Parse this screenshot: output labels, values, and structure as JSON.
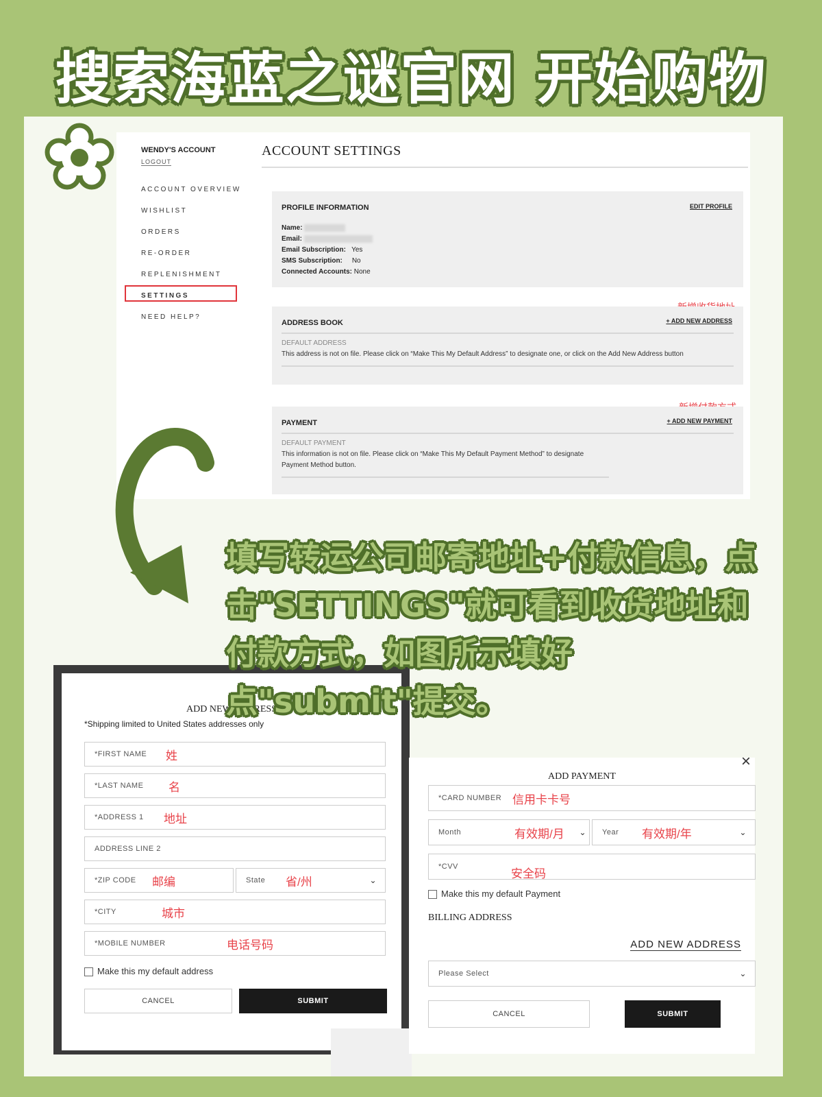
{
  "headline": "搜索海蓝之谜官网 开始购物",
  "instruction": "填写转运公司邮寄地址+付款信息，点击\"SETTINGS\"就可看到收货地址和付款方式，如图所示填好点\"submit\"提交。",
  "colors": {
    "background": "#a9c476",
    "accent_dark_green": "#5b7a32",
    "annotation_red": "#e8434a",
    "highlight_box": "#e0343a"
  },
  "account": {
    "account_name": "WENDY'S ACCOUNT",
    "logout": "LOGOUT",
    "nav": [
      "ACCOUNT OVERVIEW",
      "WISHLIST",
      "ORDERS",
      "RE-ORDER",
      "REPLENISHMENT",
      "SETTINGS",
      "NEED HELP?"
    ],
    "page_title": "ACCOUNT SETTINGS",
    "profile": {
      "title": "PROFILE INFORMATION",
      "edit": "EDIT PROFILE",
      "name_label": "Name:",
      "email_label": "Email:",
      "email_sub_label": "Email Subscription:",
      "email_sub": "Yes",
      "sms_label": "SMS Subscription:",
      "sms": "No",
      "connected_label": "Connected Accounts:",
      "connected": "None"
    },
    "address": {
      "note": "新增收货地址",
      "title": "ADDRESS BOOK",
      "add": "ADD NEW ADDRESS",
      "sub": "DEFAULT ADDRESS",
      "body": "This address is not on file. Please click on “Make This My Default Address” to designate one, or click on the Add New Address button"
    },
    "payment": {
      "note": "新增付款方式",
      "title": "PAYMENT",
      "add": "ADD NEW PAYMENT",
      "sub": "DEFAULT PAYMENT",
      "body1": "This information is not on file. Please click on “Make This My Default Payment Method” to designate",
      "body2": "Payment Method button."
    }
  },
  "address_modal": {
    "title": "ADD NEW ADDRESS",
    "notice": "*Shipping limited to United States addresses only",
    "fields": [
      {
        "label": "*FIRST NAME",
        "note": "姓"
      },
      {
        "label": "*LAST NAME",
        "note": "名"
      },
      {
        "label": "*ADDRESS 1",
        "note": "地址"
      },
      {
        "label": "ADDRESS LINE 2",
        "note": ""
      },
      {
        "label": "*ZIP CODE",
        "note": "邮编"
      },
      {
        "label": "State",
        "note": "省/州"
      },
      {
        "label": "*CITY",
        "note": "城市"
      },
      {
        "label": "*MOBILE NUMBER",
        "note": "电话号码"
      }
    ],
    "checkbox": "Make this my default address",
    "cancel": "CANCEL",
    "submit": "SUBMIT"
  },
  "payment_modal": {
    "title": "ADD PAYMENT",
    "card": {
      "label": "*CARD NUMBER",
      "note": "信用卡卡号"
    },
    "month": {
      "label": "Month",
      "note": "有效期/月"
    },
    "year": {
      "label": "Year",
      "note": "有效期/年"
    },
    "cvv": {
      "label": "*CVV",
      "note": "安全码"
    },
    "checkbox": "Make this my default Payment",
    "billing": "BILLING ADDRESS",
    "add_address": "ADD NEW ADDRESS",
    "select": "Please Select",
    "cancel": "CANCEL",
    "submit": "SUBMIT"
  }
}
